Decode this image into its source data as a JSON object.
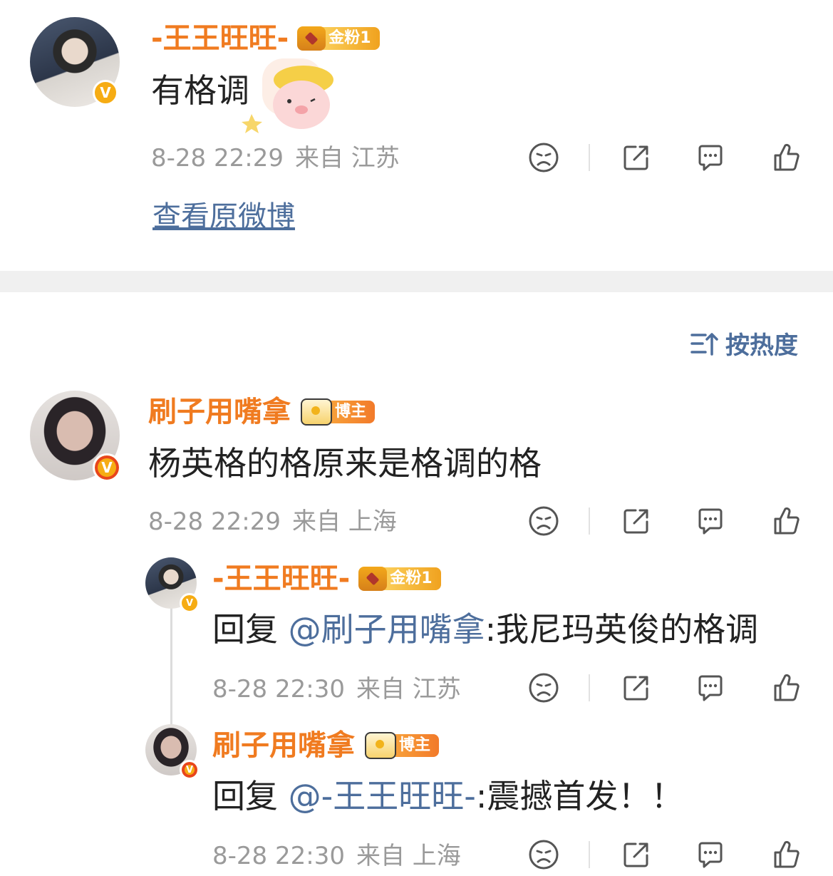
{
  "post": {
    "author": "-王王旺旺-",
    "fan_badge": "金粉1",
    "text": "有格调",
    "time": "8-28 22:29",
    "location": "来自 江苏",
    "view_original": "查看原微博"
  },
  "sort": {
    "label": "按热度"
  },
  "comments": [
    {
      "author": "刷子用嘴拿",
      "badge": "博主",
      "text": "杨英格的格原来是格调的格",
      "time": "8-28 22:29",
      "location": "来自 上海",
      "replies": [
        {
          "author": "-王王旺旺-",
          "badge": "金粉1",
          "prefix": "回复 ",
          "mention": "@刷子用嘴拿",
          "text": ":我尼玛英俊的格调",
          "time": "8-28 22:30",
          "location": "来自 江苏"
        },
        {
          "author": "刷子用嘴拿",
          "badge": "博主",
          "prefix": "回复 ",
          "mention": "@-王王旺旺-",
          "text": ":震撼首发！！",
          "time": "8-28 22:30",
          "location": "来自 上海"
        }
      ]
    }
  ],
  "icons": [
    "sad-face-icon",
    "share-icon",
    "comment-icon",
    "like-icon",
    "verified-icon",
    "sort-icon"
  ],
  "colors": {
    "username": "#f07b20",
    "link": "#4d6e9c",
    "meta": "#9a9a9a",
    "badge": "#f6ac13"
  }
}
